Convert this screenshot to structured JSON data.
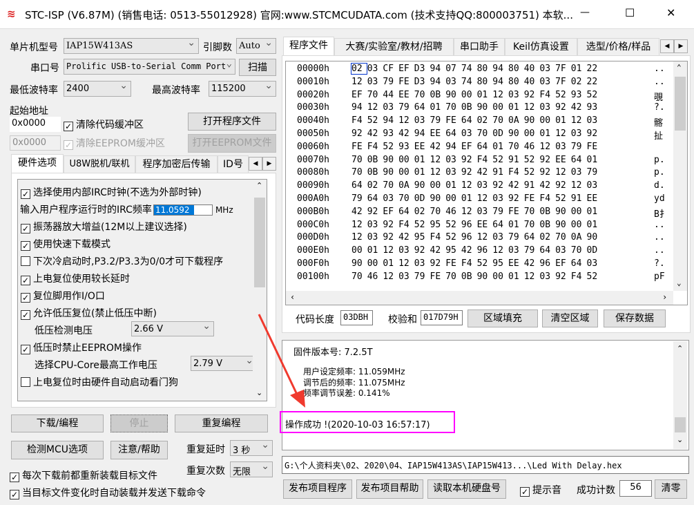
{
  "window": {
    "title": "STC-ISP (V6.87M) (销售电话: 0513-55012928) 官网:www.STCMCUDATA.com  (技术支持QQ:800003751) 本软...",
    "minimize": "—",
    "maximize": "☐",
    "close": "✕"
  },
  "left": {
    "mcu_label": "单片机型号",
    "mcu_value": "IAP15W413AS",
    "pins_label": "引脚数",
    "pins_value": "Auto",
    "port_label": "串口号",
    "port_value": "Prolific USB-to-Serial Comm Port",
    "scan": "扫描",
    "min_baud_label": "最低波特率",
    "min_baud": "2400",
    "max_baud_label": "最高波特率",
    "max_baud": "115200",
    "start_addr_label": "起始地址",
    "code_addr": "0x0000",
    "clear_code": "清除代码缓冲区",
    "open_prog": "打开程序文件",
    "eeprom_addr": "0x0000",
    "clear_eeprom": "清除EEPROM缓冲区",
    "open_eeprom": "打开EEPROM文件",
    "tabs": [
      "硬件选项",
      "U8W脱机/联机",
      "程序加密后传输",
      "ID号"
    ],
    "options": [
      {
        "checked": true,
        "label": "选择使用内部IRC时钟(不选为外部时钟)"
      },
      {
        "label": "输入用户程序运行时的IRC频率",
        "value": "11.0592",
        "unit": "MHz"
      },
      {
        "checked": true,
        "label": "振荡器放大增益(12M以上建议选择)"
      },
      {
        "checked": true,
        "label": "使用快速下载模式"
      },
      {
        "checked": false,
        "label": "下次冷启动时,P3.2/P3.3为0/0才可下载程序"
      },
      {
        "checked": true,
        "label": "上电复位使用较长延时"
      },
      {
        "checked": true,
        "label": "复位脚用作I/O口"
      },
      {
        "checked": true,
        "label": "允许低压复位(禁止低压中断)"
      },
      {
        "label": "低压检测电压",
        "value": "2.66 V"
      },
      {
        "checked": true,
        "label": "低压时禁止EEPROM操作"
      },
      {
        "label": "选择CPU-Core最高工作电压",
        "value": "2.79 V"
      },
      {
        "checked": false,
        "label": "上电复位时由硬件自动启动看门狗"
      }
    ],
    "download": "下载/编程",
    "stop": "停止",
    "repeat": "重复编程",
    "detect": "检测MCU选项",
    "help": "注意/帮助",
    "delay_label": "重复延时",
    "delay_value": "3 秒",
    "count_label": "重复次数",
    "count_value": "无限",
    "reload": "每次下载前都重新装载目标文件",
    "auto": "当目标文件变化时自动装载并发送下载命令"
  },
  "right": {
    "tabs": [
      "程序文件",
      "大赛/实验室/教材/招聘",
      "串口助手",
      "Keil仿真设置",
      "选型/价格/样品"
    ],
    "hex": [
      {
        "addr": "00000h",
        "bytes": "02 03 CF EF D3 94 07 74 80 94 80 40 03 7F 01 22",
        "ascii": ".."
      },
      {
        "addr": "00010h",
        "bytes": "12 03 79 FE D3 94 03 74 80 94 80 40 03 7F 02 22",
        "ascii": ".."
      },
      {
        "addr": "00020h",
        "bytes": "EF 70 44 EE 70 0B 90 00 01 12 03 92 F4 52 93 52",
        "ascii": "覗"
      },
      {
        "addr": "00030h",
        "bytes": "94 12 03 79 64 01 70 0B 90 00 01 12 03 92 42 93",
        "ascii": "?."
      },
      {
        "addr": "00040h",
        "bytes": "F4 52 94 12 03 79 FE 64 02 70 0A 90 00 01 12 03",
        "ascii": "髂"
      },
      {
        "addr": "00050h",
        "bytes": "92 42 93 42 94 EE 64 03 70 0D 90 00 01 12 03 92",
        "ascii": "扯"
      },
      {
        "addr": "00060h",
        "bytes": "FE F4 52 93 EE 42 94 EF 64 01 70 46 12 03 79 FE",
        "ascii": ""
      },
      {
        "addr": "00070h",
        "bytes": "70 0B 90 00 01 12 03 92 F4 52 91 52 92 EE 64 01",
        "ascii": "p."
      },
      {
        "addr": "00080h",
        "bytes": "70 0B 90 00 01 12 03 92 42 91 F4 52 92 12 03 79",
        "ascii": "p."
      },
      {
        "addr": "00090h",
        "bytes": "64 02 70 0A 90 00 01 12 03 92 42 91 42 92 12 03",
        "ascii": "d."
      },
      {
        "addr": "000A0h",
        "bytes": "79 64 03 70 0D 90 00 01 12 03 92 FE F4 52 91 EE",
        "ascii": "yd"
      },
      {
        "addr": "000B0h",
        "bytes": "42 92 EF 64 02 70 46 12 03 79 FE 70 0B 90 00 01",
        "ascii": "B扌"
      },
      {
        "addr": "000C0h",
        "bytes": "12 03 92 F4 52 95 52 96 EE 64 01 70 0B 90 00 01",
        "ascii": ".."
      },
      {
        "addr": "000D0h",
        "bytes": "12 03 92 42 95 F4 52 96 12 03 79 64 02 70 0A 90",
        "ascii": ".."
      },
      {
        "addr": "000E0h",
        "bytes": "00 01 12 03 92 42 95 42 96 12 03 79 64 03 70 0D",
        "ascii": ".."
      },
      {
        "addr": "000F0h",
        "bytes": "90 00 01 12 03 92 FE F4 52 95 EE 42 96 EF 64 03",
        "ascii": "?."
      },
      {
        "addr": "00100h",
        "bytes": "70 46 12 03 79 FE 70 0B 90 00 01 12 03 92 F4 52",
        "ascii": "pF"
      }
    ],
    "code_len_label": "代码长度",
    "code_len": "03DBH",
    "checksum_label": "校验和",
    "checksum": "017D79H",
    "fill": "区域填充",
    "clear": "清空区域",
    "save": "保存数据",
    "log": {
      "firmware": "固件版本号: 7.2.5T",
      "user_freq": "用户设定频率: 11.059MHz",
      "adj_freq": "调节后的频率: 11.075MHz",
      "error": "频率调节误差: 0.141%",
      "success": "操作成功 !(2020-10-03 16:57:17)"
    },
    "path": "G:\\个人资料夹\\02、2020\\04、IAP15W413AS\\IAP15W413...\\Led With Delay.hex",
    "publish": "发布项目程序",
    "publish_help": "发布项目帮助",
    "read_disk": "读取本机硬盘号",
    "beep": "提示音",
    "success_label": "成功计数",
    "success_count": "56",
    "reset": "清零"
  },
  "colors": {
    "highlight": "#ff00ff",
    "arrow": "#f03a2e",
    "selection": "#0078d7"
  }
}
